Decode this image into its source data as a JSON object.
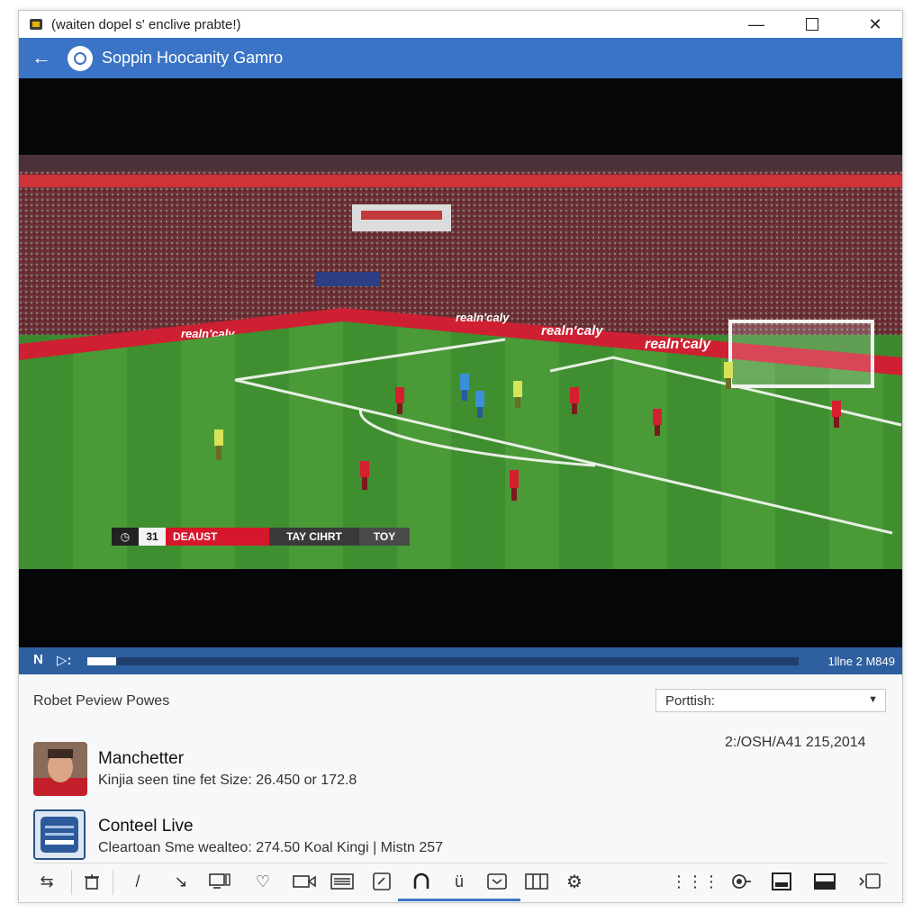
{
  "window": {
    "title": "(waiten dopel s' enclive prabte!)",
    "minimize_glyph": "—",
    "close_glyph": "✕"
  },
  "appbar": {
    "back_glyph": "←",
    "title": "Soppin Hoocanity Gamro",
    "color": "#3b74c6"
  },
  "scorebug": {
    "clock_glyph": "◷",
    "minute": "31",
    "home": "DEAUST",
    "away": "TAY CIHRT",
    "extra": "TOY"
  },
  "pitch_boards": [
    "realn'caly",
    "realn'caly",
    "realn'caly",
    "realn'caly",
    "realn'caly"
  ],
  "player": {
    "left_label": "N",
    "play_label": "▷:",
    "progress": 0.04,
    "time_readout": "1llne  2 M849"
  },
  "panel": {
    "heading": "Robet Peview Powes",
    "dropdown_value": "Porttish:",
    "dropdown_caret": "▼",
    "items": [
      {
        "title": "Manchetter",
        "subtitle": "Kinjia seen tine fet Size: 26.450 or 172.8",
        "meta": "2:/OSH/A41 215,2014"
      },
      {
        "title": "Conteel Live",
        "subtitle": "Cleartoan Sme wealteo: 274.50 Koal Kingi | Mistn 257"
      }
    ]
  },
  "toolbar": {
    "icons": [
      "swap-icon",
      "trash-icon",
      "pen-icon",
      "pointer-icon",
      "monitor-icon",
      "heart-icon",
      "camera-icon",
      "keyboard-icon",
      "edit-box-icon",
      "headphones-icon",
      "mic-icon",
      "inbox-icon",
      "split-view-icon",
      "gear-icon",
      "grid-icon",
      "record-icon",
      "image-icon",
      "fullscreen-icon",
      "cast-icon"
    ]
  }
}
